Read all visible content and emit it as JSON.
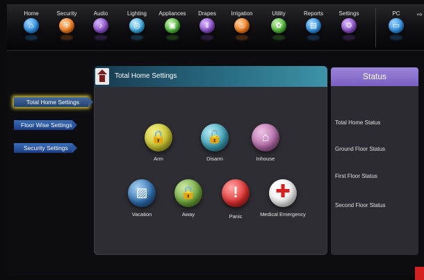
{
  "nav": {
    "items": [
      {
        "label": "Home",
        "icon": "home-icon",
        "color": "#2f8fe0",
        "glyph": "⌂"
      },
      {
        "label": "Security",
        "icon": "shield-icon",
        "color": "#f07a1c",
        "glyph": "⛨"
      },
      {
        "label": "Audio",
        "icon": "music-icon",
        "color": "#8a4fc7",
        "glyph": "♪"
      },
      {
        "label": "Lighting",
        "icon": "lightbulb-icon",
        "color": "#3aa7e0",
        "glyph": "◎"
      },
      {
        "label": "Appliances",
        "icon": "appliance-icon",
        "color": "#4fb83a",
        "glyph": "▣"
      },
      {
        "label": "Drapes",
        "icon": "drapes-icon",
        "color": "#8a4fc7",
        "glyph": "Ⅱ"
      },
      {
        "label": "Irrigation",
        "icon": "irrigation-icon",
        "color": "#f07a1c",
        "glyph": "♨"
      },
      {
        "label": "Utility",
        "icon": "utility-icon",
        "color": "#4fb83a",
        "glyph": "✿"
      },
      {
        "label": "Reports",
        "icon": "reports-icon",
        "color": "#2f8fe0",
        "glyph": "▤"
      },
      {
        "label": "Settings",
        "icon": "settings-icon",
        "color": "#8a4fc7",
        "glyph": "⚙"
      },
      {
        "label": "PC",
        "icon": "monitor-icon",
        "color": "#2f8fe0",
        "glyph": "▭"
      }
    ]
  },
  "sidebar": {
    "items": [
      {
        "label": "Total Home Settings",
        "active": true
      },
      {
        "label": "Floor Wise Settings",
        "active": false
      },
      {
        "label": "Security Settings",
        "active": false
      }
    ]
  },
  "main": {
    "title": "Total Home Settings",
    "modes": [
      {
        "label": "Arm",
        "icon": "padlock-icon",
        "color": "#c8c42e",
        "glyph": "🔒"
      },
      {
        "label": "Disarm",
        "icon": "unlocked-padlock-icon",
        "color": "#3a9fb5",
        "glyph": "🔓"
      },
      {
        "label": "Inhouse",
        "icon": "house-icon",
        "color": "#b56aa8",
        "glyph": "⌂"
      },
      {
        "label": "Vacation",
        "icon": "vacation-icon",
        "color": "#2e6fb0",
        "glyph": "▨"
      },
      {
        "label": "Away",
        "icon": "away-icon",
        "color": "#6ea63a",
        "glyph": "🔒"
      },
      {
        "label": "Panic",
        "icon": "exclamation-icon",
        "color": "#e0302e",
        "glyph": "!"
      },
      {
        "label": "Medical Emergency",
        "icon": "medical-cross-icon",
        "color": "#f2f2f2",
        "glyph": "✚"
      }
    ]
  },
  "status": {
    "title": "Status",
    "items": [
      "Total Home Status",
      "Ground Floor Status",
      "First Floor Status",
      "Second Floor Status"
    ]
  }
}
